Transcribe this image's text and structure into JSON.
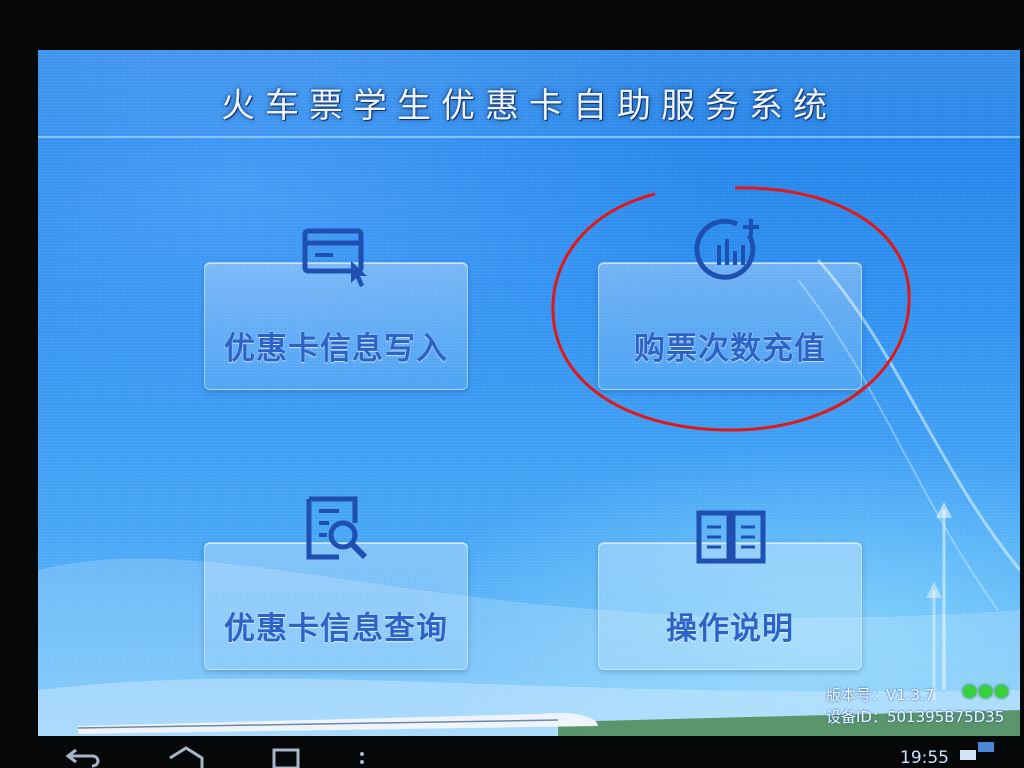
{
  "app": {
    "title": "火车票学生优惠卡自助服务系统"
  },
  "menu": {
    "items": [
      {
        "label": "优惠卡信息写入",
        "icon": "card-write-icon"
      },
      {
        "label": "购票次数充值",
        "icon": "recharge-chart-icon"
      },
      {
        "label": "优惠卡信息查询",
        "icon": "document-search-icon"
      },
      {
        "label": "操作说明",
        "icon": "open-book-icon"
      }
    ]
  },
  "footer": {
    "version": "版本号：V1.3.7",
    "device_id": "设备ID：501395B75D35"
  },
  "system_bar": {
    "time": "19:55"
  },
  "colors": {
    "accent": "#2b63c8",
    "status_green": "#39d23c",
    "annotation_red": "#e01818"
  }
}
